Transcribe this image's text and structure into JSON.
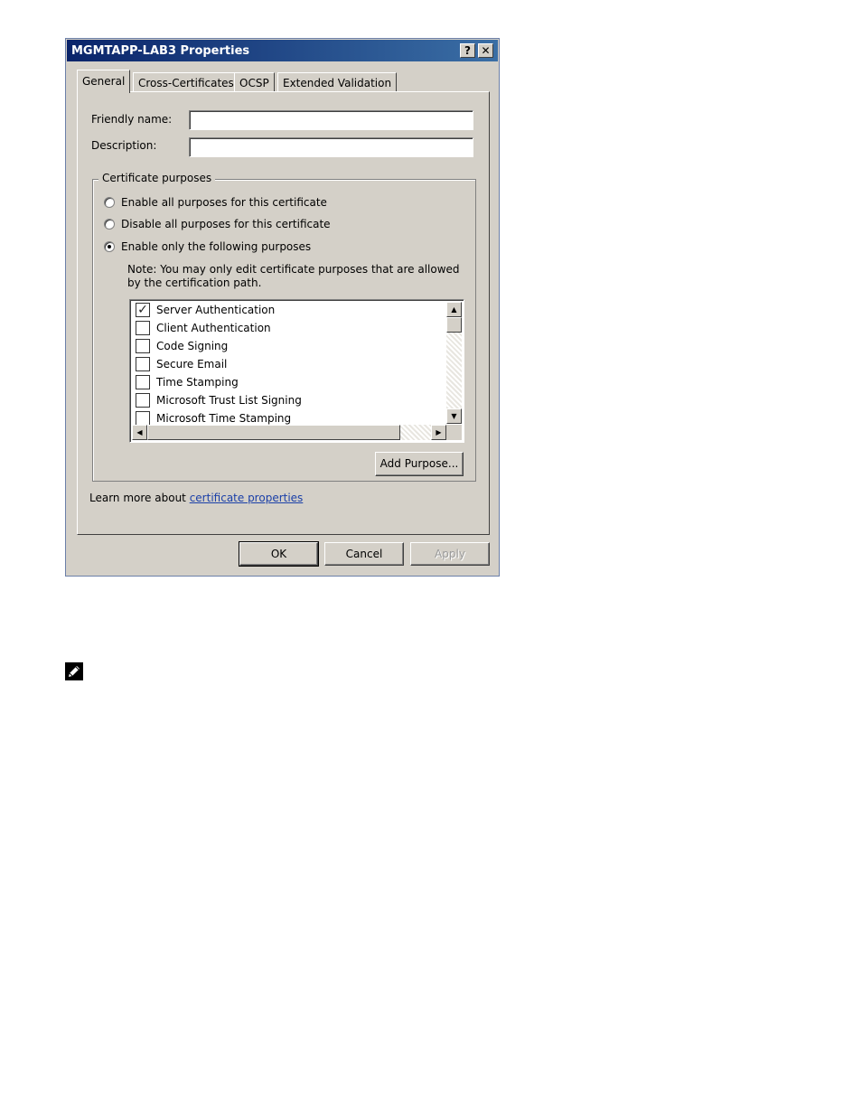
{
  "window": {
    "title": "MGMTAPP-LAB3 Properties",
    "help_label": "?",
    "close_label": "✕"
  },
  "tabs": [
    {
      "label": "General",
      "active": true
    },
    {
      "label": "Cross-Certificates",
      "active": false
    },
    {
      "label": "OCSP",
      "active": false
    },
    {
      "label": "Extended Validation",
      "active": false
    }
  ],
  "general": {
    "friendly_name_label": "Friendly name:",
    "friendly_name_value": "",
    "description_label": "Description:",
    "description_value": "",
    "purposes_group_label": "Certificate purposes",
    "radio_options": [
      {
        "label": "Enable all purposes for this certificate",
        "selected": false
      },
      {
        "label": "Disable all purposes for this certificate",
        "selected": false
      },
      {
        "label": "Enable only the following purposes",
        "selected": true
      }
    ],
    "note": "Note: You may only edit certificate purposes that are allowed by the certification path.",
    "purposes": [
      {
        "label": "Server Authentication",
        "checked": true
      },
      {
        "label": "Client Authentication",
        "checked": false
      },
      {
        "label": "Code Signing",
        "checked": false
      },
      {
        "label": "Secure Email",
        "checked": false
      },
      {
        "label": "Time Stamping",
        "checked": false
      },
      {
        "label": "Microsoft Trust List Signing",
        "checked": false
      },
      {
        "label": "Microsoft Time Stamping",
        "checked": false
      }
    ],
    "add_purpose_label": "Add Purpose...",
    "learn_more_prefix": "Learn more about ",
    "learn_more_link": "certificate properties"
  },
  "footer": {
    "ok_label": "OK",
    "cancel_label": "Cancel",
    "apply_label": "Apply",
    "apply_enabled": false
  },
  "page_note_icon": "pencil-note-icon"
}
